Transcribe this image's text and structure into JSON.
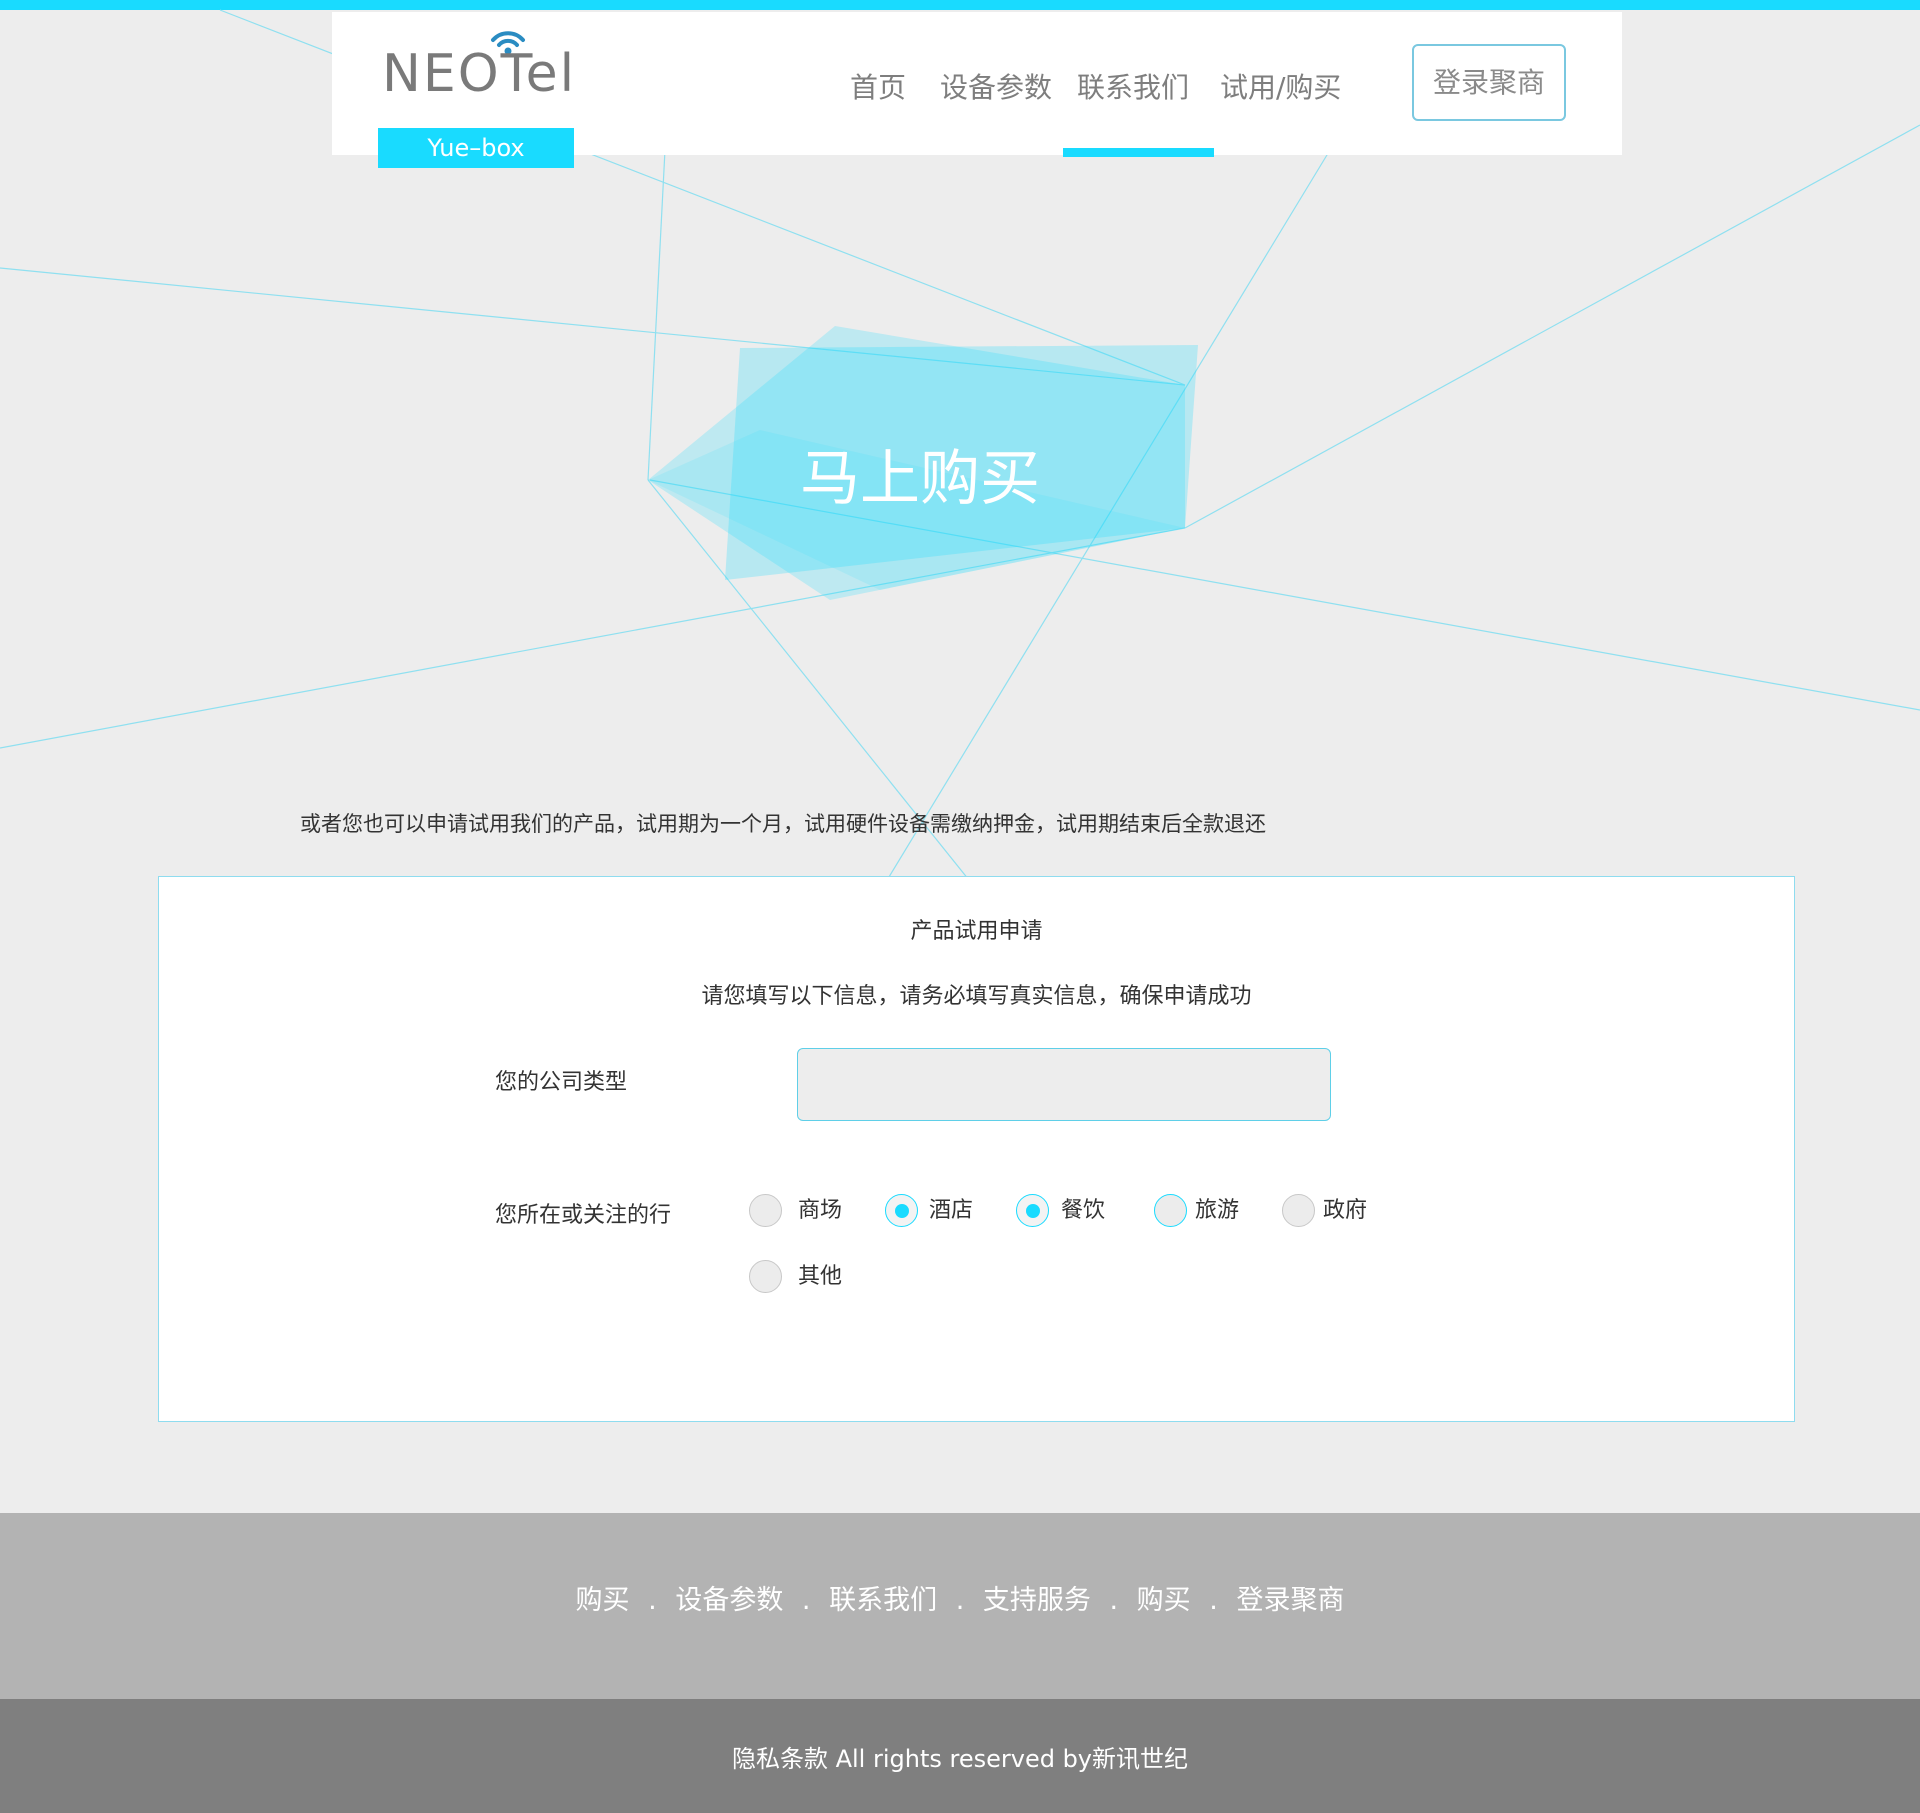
{
  "brand": {
    "logo_text": "NEOTel",
    "badge": "Yue–box",
    "accent_color": "#19dbff"
  },
  "nav": {
    "items": [
      {
        "label": "首页"
      },
      {
        "label": "设备参数"
      },
      {
        "label": "联系我们"
      },
      {
        "label": "试用/购买"
      }
    ],
    "active_index": 2,
    "login_button": "登录聚商"
  },
  "hero": {
    "title": "马上购买"
  },
  "intro_text": "或者您也可以申请试用我们的产品，试用期为一个月，试用硬件设备需缴纳押金，试用期结束后全款退还",
  "form": {
    "title": "产品试用申请",
    "subtitle": "请您填写以下信息，请务必填写真实信息，确保申请成功",
    "company_type": {
      "label": "您的公司类型",
      "value": "",
      "placeholder": ""
    },
    "industry": {
      "label": "您所在或关注的行",
      "options": [
        {
          "label": "商场",
          "checked": false
        },
        {
          "label": "酒店",
          "checked": true
        },
        {
          "label": "餐饮",
          "checked": true
        },
        {
          "label": "旅游",
          "checked": false
        },
        {
          "label": "政府",
          "checked": false
        },
        {
          "label": "其他",
          "checked": false
        }
      ]
    }
  },
  "footer": {
    "links": [
      "购买",
      "设备参数",
      "联系我们",
      "支持服务",
      "购买",
      "登录聚商"
    ],
    "separator": ".",
    "copyright": "隐私条款 All rights reserved by新讯世纪"
  }
}
